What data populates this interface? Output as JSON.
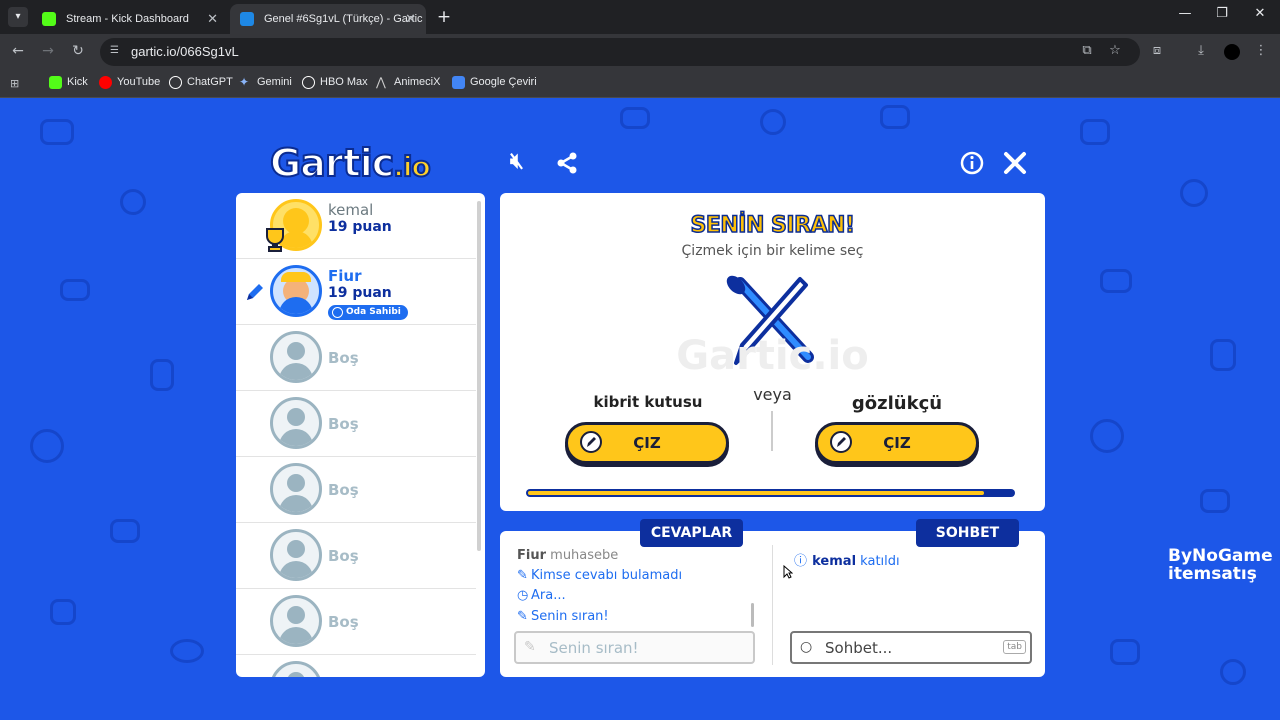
{
  "browser": {
    "tabs": [
      {
        "title": "Stream - Kick Dashboard",
        "color": "#53fc18"
      },
      {
        "title": "Genel #6Sg1vL (Türkçe) - Gartic",
        "color": "#1e88e5"
      }
    ],
    "url": "gartic.io/066Sg1vL",
    "bookmarks": [
      {
        "label": "Kick",
        "color": "#53fc18"
      },
      {
        "label": "YouTube",
        "color": "#ff0000"
      },
      {
        "label": "ChatGPT",
        "color": "#ffffff"
      },
      {
        "label": "Gemini",
        "color": "#8ab4f8"
      },
      {
        "label": "HBO Max",
        "color": "#ffffff"
      },
      {
        "label": "AnimeciX",
        "color": "#cccccc"
      },
      {
        "label": "Google Çeviri",
        "color": "#4285f4"
      }
    ]
  },
  "game": {
    "logo_main": "Gartic",
    "logo_suffix": ".io",
    "players": [
      {
        "name": "kemal",
        "points": "19 puan"
      },
      {
        "name": "Fiur",
        "points": "19 puan",
        "badge": "Oda Sahibi"
      }
    ],
    "empty_slot": "Boş",
    "turn": {
      "title": "SENİN SIRAN!",
      "subtitle": "Çizmek için bir kelime seç",
      "word_left": "kibrit kutusu",
      "word_right": "gözlükçü",
      "or": "veya",
      "draw_label": "ÇIZ",
      "time_left_fraction": 0.94
    },
    "answers": {
      "tab": "CEVAPLAR",
      "entries": [
        {
          "user": "Fiur",
          "text": "muhasebe"
        },
        {
          "text": "Kimse cevabı bulamadı",
          "icon": "pencil-icon"
        },
        {
          "text": "Ara...",
          "icon": "clock-icon"
        },
        {
          "text": "Senin sıran!",
          "icon": "pencil-icon"
        }
      ],
      "input_placeholder": "Senin sıran!"
    },
    "chat": {
      "tab": "SOHBET",
      "join_user": "kemal",
      "join_text": "katıldı",
      "input_placeholder": "Sohbet...",
      "key_hint": "tab"
    },
    "watermark_line1": "ByNoGame",
    "watermark_line2": "itemsatış"
  }
}
